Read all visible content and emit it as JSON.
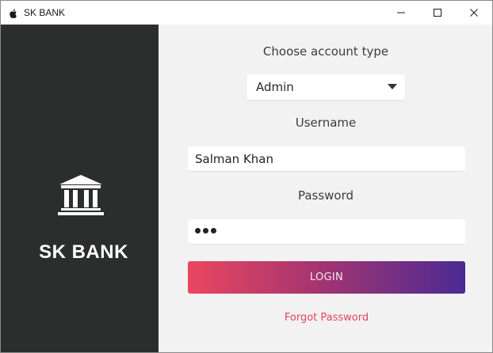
{
  "window": {
    "title": "SK BANK",
    "icon": "apple-icon",
    "controls": [
      "minimize-icon",
      "maximize-icon",
      "close-icon"
    ]
  },
  "brand": {
    "icon": "bank-icon",
    "title": "SK BANK"
  },
  "form": {
    "account_type_label": "Choose account type",
    "account_type_value": "Admin",
    "username_label": "Username",
    "username_value": "Salman Khan",
    "password_label": "Password",
    "password_masked_length": 3,
    "login_label": "LOGIN",
    "forgot_label": "Forgot Password"
  },
  "colors": {
    "left_panel": "#2c2e2d",
    "form_background": "#f2f2f2",
    "button_gradient_start": "#ea4760",
    "button_gradient_end": "#4c2a94",
    "forgot_link": "#e0465e"
  }
}
